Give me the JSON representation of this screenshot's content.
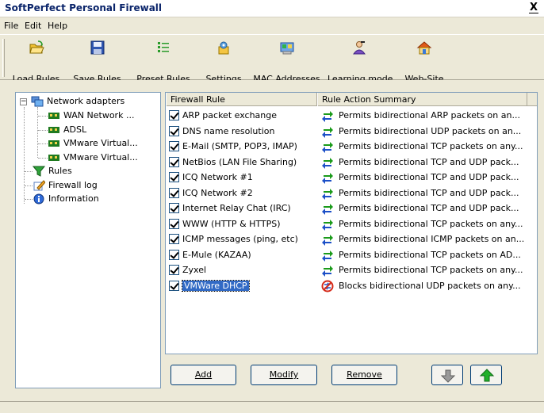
{
  "window": {
    "title": "SoftPerfect Personal Firewall",
    "close_label": "X"
  },
  "menu": [
    "File",
    "Edit",
    "Help"
  ],
  "toolbar": [
    {
      "label": "Load Rules",
      "icon": "folder-open-icon"
    },
    {
      "label": "Save Rules",
      "icon": "floppy-disk-icon"
    },
    {
      "label": "Preset Rules",
      "icon": "list-icon"
    },
    {
      "label": "Settings",
      "icon": "settings-icon"
    },
    {
      "label": "MAC Addresses",
      "icon": "network-card-icon"
    },
    {
      "label": "Learning mode",
      "icon": "learning-user-icon"
    },
    {
      "label": "Web-Site",
      "icon": "home-icon"
    }
  ],
  "tree": {
    "root": "Network adapters",
    "adapters": [
      "WAN Network ...",
      "ADSL",
      "VMware Virtual...",
      "VMware Virtual..."
    ],
    "items": [
      "Rules",
      "Firewall log",
      "Information"
    ]
  },
  "rules_table": {
    "columns": [
      "Firewall Rule",
      "Rule Action Summary"
    ],
    "rows": [
      {
        "name": "ARP packet exchange",
        "summary": "Permits bidirectional ARP packets on an...",
        "action": "permit",
        "checked": true
      },
      {
        "name": "DNS name resolution",
        "summary": "Permits bidirectional UDP packets on an...",
        "action": "permit",
        "checked": true
      },
      {
        "name": "E-Mail (SMTP, POP3, IMAP)",
        "summary": "Permits bidirectional TCP packets on any...",
        "action": "permit",
        "checked": true
      },
      {
        "name": "NetBios (LAN File Sharing)",
        "summary": "Permits bidirectional TCP and UDP pack...",
        "action": "permit",
        "checked": true
      },
      {
        "name": "ICQ Network #1",
        "summary": "Permits bidirectional TCP and UDP pack...",
        "action": "permit",
        "checked": true
      },
      {
        "name": "ICQ Network #2",
        "summary": "Permits bidirectional TCP and UDP pack...",
        "action": "permit",
        "checked": true
      },
      {
        "name": "Internet Relay Chat (IRC)",
        "summary": "Permits bidirectional TCP and UDP pack...",
        "action": "permit",
        "checked": true
      },
      {
        "name": "WWW (HTTP & HTTPS)",
        "summary": "Permits bidirectional TCP packets on any...",
        "action": "permit",
        "checked": true
      },
      {
        "name": "ICMP messages (ping, etc)",
        "summary": "Permits bidirectional ICMP packets on an...",
        "action": "permit",
        "checked": true
      },
      {
        "name": "E-Mule (KAZAA)",
        "summary": "Permits bidirectional TCP packets on AD...",
        "action": "permit",
        "checked": true
      },
      {
        "name": "Zyxel",
        "summary": "Permits bidirectional TCP packets on any...",
        "action": "permit",
        "checked": true
      },
      {
        "name": "VMWare DHCP",
        "summary": "Blocks bidirectional UDP packets on any...",
        "action": "block",
        "checked": true,
        "selected": true
      }
    ]
  },
  "buttons": {
    "add": "Add",
    "modify": "Modify",
    "remove": "Remove"
  },
  "colors": {
    "permit_green": "#1a9a1a",
    "permit_blue": "#1c4fc7",
    "block_red": "#d42a1a",
    "selection": "#316ac5"
  }
}
